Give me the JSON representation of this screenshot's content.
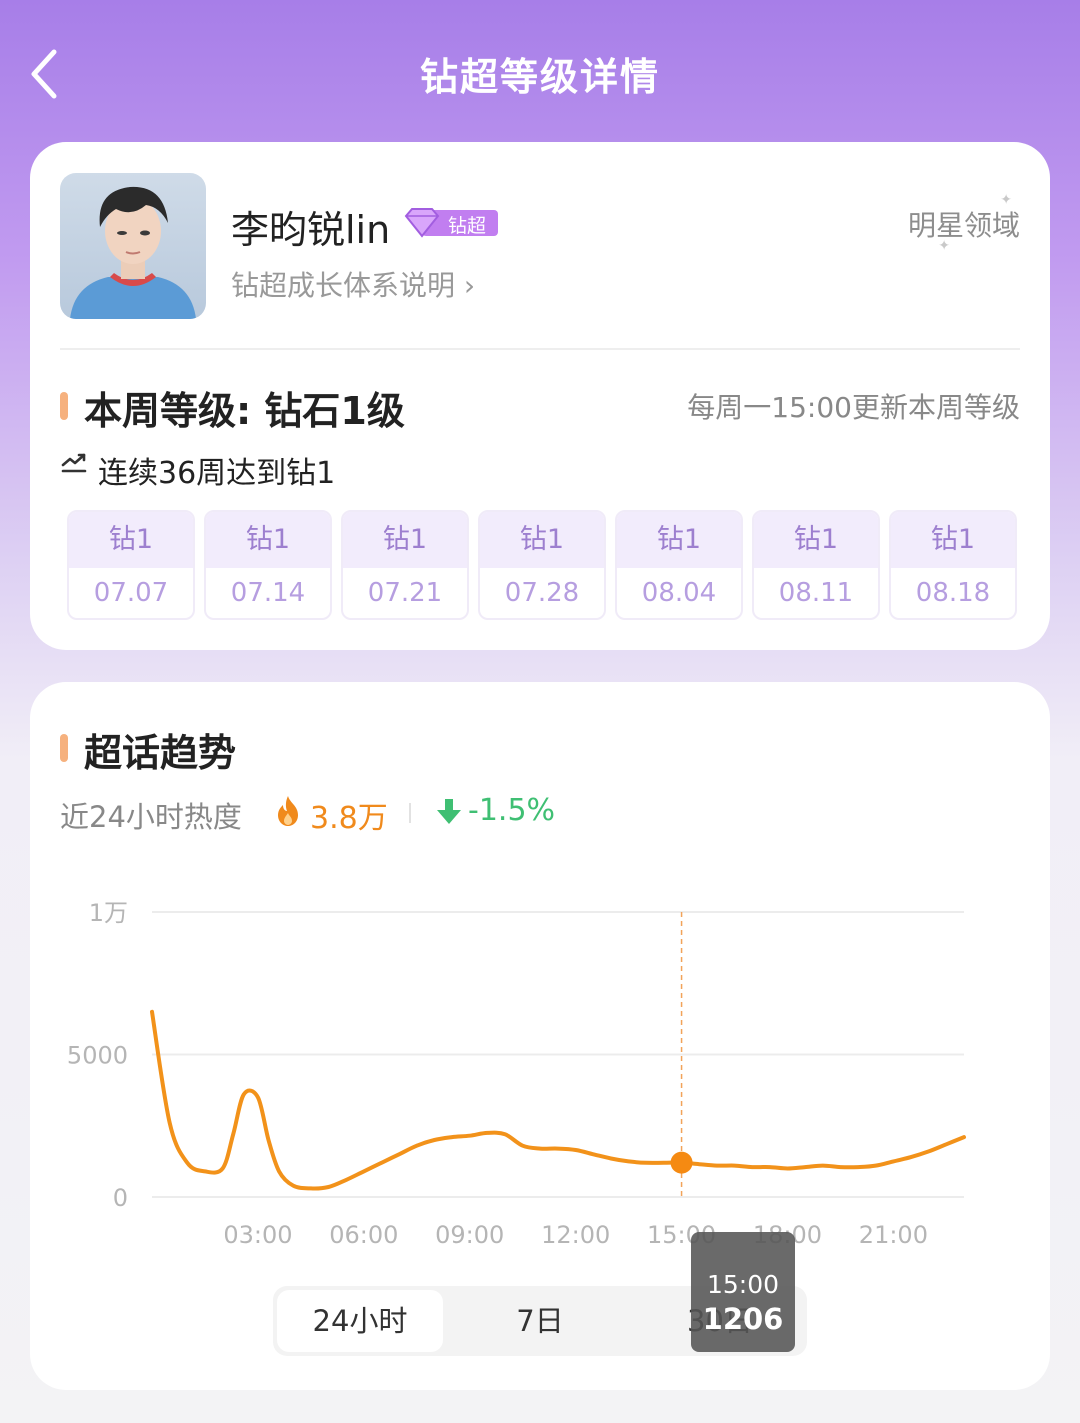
{
  "header": {
    "title": "钻超等级详情"
  },
  "profile": {
    "name": "李昀锐lin",
    "badge_label": "钻超",
    "subtitle_link": "钻超成长体系说明 ›",
    "domain_tag": "明星领域"
  },
  "level_section": {
    "title": "本周等级: 钻石1级",
    "update_note": "每周一15:00更新本周等级",
    "streak_text": "连续36周达到钻1",
    "weeks": [
      {
        "level": "钻1",
        "date": "07.07"
      },
      {
        "level": "钻1",
        "date": "07.14"
      },
      {
        "level": "钻1",
        "date": "07.21"
      },
      {
        "level": "钻1",
        "date": "07.28"
      },
      {
        "level": "钻1",
        "date": "08.04"
      },
      {
        "level": "钻1",
        "date": "08.11"
      },
      {
        "level": "钻1",
        "date": "08.18"
      }
    ]
  },
  "trend_section": {
    "title": "超话趋势",
    "heat_label": "近24小时热度",
    "heat_value": "3.8万",
    "change_value": "-1.5%"
  },
  "chart_data": {
    "type": "line",
    "y_ticks": [
      "1万",
      "5000",
      "0"
    ],
    "ylim": [
      0,
      10000
    ],
    "x_ticks": [
      "03:00",
      "06:00",
      "09:00",
      "12:00",
      "15:00",
      "18:00",
      "21:00"
    ],
    "xlim": [
      0,
      23
    ],
    "grid": true,
    "color": "#f2921a",
    "x": [
      0,
      0.5,
      1,
      1.5,
      2,
      2.3,
      2.6,
      3,
      3.3,
      3.6,
      4,
      4.5,
      5,
      5.5,
      6,
      6.5,
      7,
      7.5,
      8,
      8.5,
      9,
      9.5,
      10,
      10.5,
      11,
      11.5,
      12,
      12.5,
      13,
      13.5,
      14,
      14.5,
      15,
      15.5,
      16,
      16.5,
      17,
      17.5,
      18,
      18.5,
      19,
      19.5,
      20,
      20.5,
      21,
      21.5,
      22,
      22.5,
      23
    ],
    "y": [
      6500,
      2600,
      1200,
      900,
      1000,
      2200,
      3600,
      3500,
      2000,
      900,
      400,
      300,
      350,
      600,
      900,
      1200,
      1500,
      1800,
      2000,
      2100,
      2150,
      2250,
      2200,
      1800,
      1700,
      1700,
      1650,
      1500,
      1350,
      1250,
      1200,
      1200,
      1206,
      1150,
      1100,
      1100,
      1050,
      1050,
      1000,
      1050,
      1100,
      1050,
      1050,
      1100,
      1250,
      1400,
      1600,
      1850,
      2100
    ],
    "highlight": {
      "x": 15,
      "time": "15:00",
      "value": "1206"
    }
  },
  "range_tabs": [
    {
      "label": "24小时",
      "active": true
    },
    {
      "label": "7日",
      "active": false
    },
    {
      "label": "30日",
      "active": false
    }
  ],
  "colors": {
    "accent_bar": "#f6b17e",
    "heat_orange": "#f08a1c",
    "down_green": "#3fbf73",
    "badge_purple": "#c17ef0",
    "week_text": "#b69ee0"
  }
}
